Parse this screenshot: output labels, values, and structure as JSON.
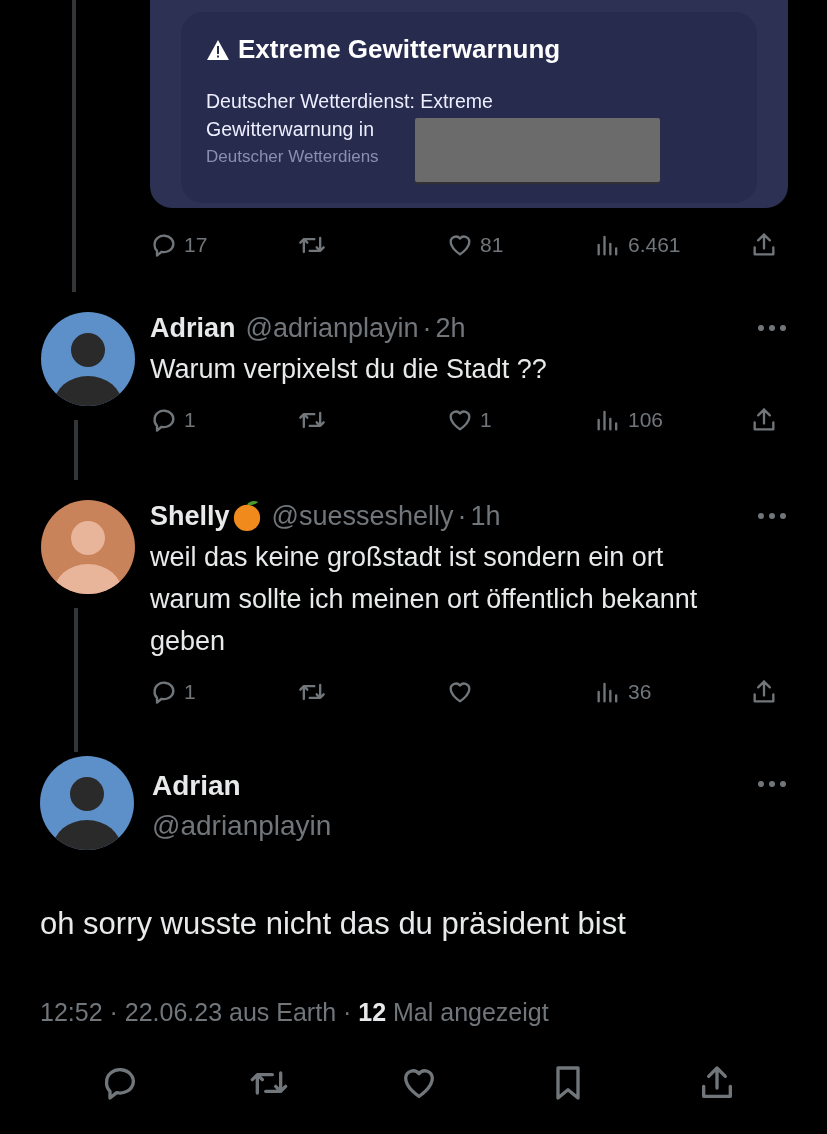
{
  "quoted_post": {
    "warning_title": "Extreme Gewitterwarnung",
    "warning_body": "Deutscher Wetterdienst: Extreme Gewitterwarnung in",
    "warning_source": "Deutscher Wetterdiens",
    "stats": [
      {
        "kind": "reply",
        "count": "17"
      },
      {
        "kind": "repost"
      },
      {
        "kind": "like",
        "count": "81"
      },
      {
        "kind": "views",
        "count": "6.461"
      },
      {
        "kind": "share"
      }
    ]
  },
  "replies": [
    {
      "name": "Adrian",
      "handle": "@adrianplayin",
      "separator": "·",
      "time": "2h",
      "text": "Warum verpixelst du die Stadt ??",
      "stats": [
        {
          "kind": "reply",
          "count": "1"
        },
        {
          "kind": "repost"
        },
        {
          "kind": "like",
          "count": "1"
        },
        {
          "kind": "views",
          "count": "106"
        },
        {
          "kind": "share"
        }
      ]
    },
    {
      "name": "Shelly",
      "fruit_badge": true,
      "handle": "@suesseshelly",
      "separator": "·",
      "time": "1h",
      "text": "weil das keine großstadt ist sondern ein ort warum sollte ich meinen ort öffentlich bekannt geben",
      "stats": [
        {
          "kind": "reply",
          "count": "1"
        },
        {
          "kind": "repost"
        },
        {
          "kind": "like"
        },
        {
          "kind": "views",
          "count": "36"
        },
        {
          "kind": "share"
        }
      ]
    }
  ],
  "main_post": {
    "name": "Adrian",
    "handle": "@adrianplayin",
    "text": "oh sorry wusste nicht das du präsident bist",
    "meta": "12:52 · 22.06.23 aus Earth · **12** Mal angezeigt",
    "actions": [
      {
        "kind": "reply"
      },
      {
        "kind": "repost"
      },
      {
        "kind": "like"
      },
      {
        "kind": "bookmark"
      },
      {
        "kind": "share"
      }
    ]
  }
}
